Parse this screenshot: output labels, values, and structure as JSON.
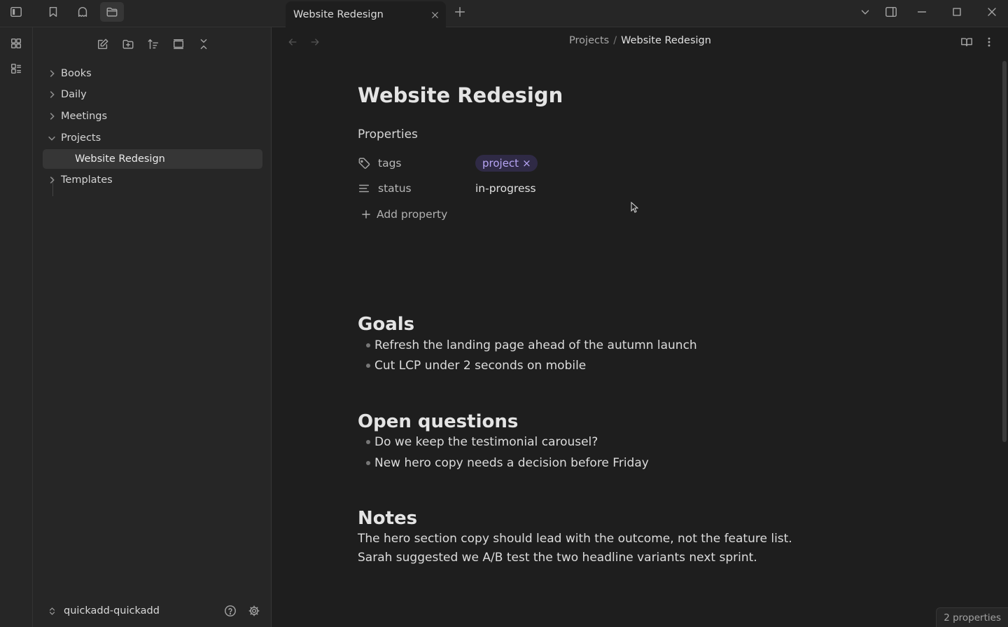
{
  "titlebar": {
    "tab_title": "Website Redesign"
  },
  "sidebar": {
    "tree": [
      {
        "label": "Books",
        "expanded": false
      },
      {
        "label": "Daily",
        "expanded": false
      },
      {
        "label": "Meetings",
        "expanded": false
      },
      {
        "label": "Projects",
        "expanded": true
      },
      {
        "label": "Website Redesign",
        "selected": true
      },
      {
        "label": "Templates",
        "expanded": false
      }
    ],
    "vault_name": "quickadd-quickadd"
  },
  "breadcrumb": {
    "parent": "Projects",
    "separator": "/",
    "current": "Website Redesign"
  },
  "note": {
    "title": "Website Redesign",
    "properties_heading": "Properties",
    "properties": [
      {
        "key": "tags",
        "value": "project",
        "icon": "tag-icon"
      },
      {
        "key": "status",
        "value": "in-progress",
        "icon": "text-lines-icon"
      }
    ],
    "tag_remove": "×",
    "add_property": "Add property",
    "sections": {
      "goals": {
        "heading": "Goals",
        "items": [
          "Refresh the landing page ahead of the autumn launch",
          "Cut LCP under 2 seconds on mobile"
        ]
      },
      "questions": {
        "heading": "Open questions",
        "items": [
          "Do we keep the testimonial carousel?",
          "New hero copy needs a decision before Friday"
        ]
      },
      "notes": {
        "heading": "Notes",
        "lines": [
          "The hero section copy should lead with the outcome, not the feature list.",
          "Sarah suggested we A/B test the two headline variants next sprint."
        ]
      }
    }
  },
  "status_bar": {
    "properties_count": "2 properties"
  },
  "colors": {
    "background": "#1e1e1e",
    "panel": "#262626",
    "tag_bg": "#2f2a45",
    "tag_text": "#b7a5f5"
  }
}
